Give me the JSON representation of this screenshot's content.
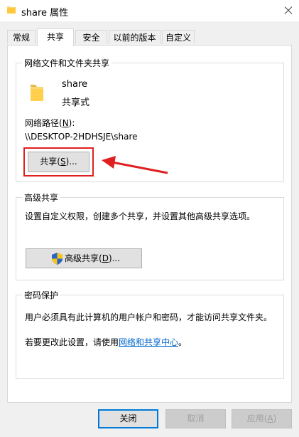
{
  "window": {
    "title": "share 属性",
    "close_icon": "close-icon"
  },
  "tabs": [
    {
      "label": "常规",
      "active": false
    },
    {
      "label": "共享",
      "active": true
    },
    {
      "label": "安全",
      "active": false
    },
    {
      "label": "以前的版本",
      "active": false
    },
    {
      "label": "自定义",
      "active": false
    }
  ],
  "network_sharing": {
    "group_title": "网络文件和文件夹共享",
    "folder_name": "share",
    "share_status": "共享式",
    "path_label_prefix": "网络路径(",
    "path_label_key": "N",
    "path_label_suffix": "):",
    "path_value": "\\\\DESKTOP-2HDHSJE\\share",
    "share_button_prefix": "共享(",
    "share_button_key": "S",
    "share_button_suffix": ")...",
    "highlight_color": "#e02020"
  },
  "advanced_sharing": {
    "group_title": "高级共享",
    "description": "设置自定义权限，创建多个共享，并设置其他高级共享选项。",
    "button_prefix": "高级共享(",
    "button_key": "D",
    "button_suffix": ")..."
  },
  "password_protection": {
    "group_title": "密码保护",
    "description": "用户必须具有此计算机的用户帐户和密码，才能访问共享文件夹。",
    "change_prefix": "若要更改此设置，请使用",
    "change_link": "网络和共享中心",
    "change_suffix": "。"
  },
  "footer": {
    "close_label": "关闭",
    "cancel_label": "取消",
    "apply_prefix": "应用(",
    "apply_key": "A",
    "apply_suffix": ")"
  },
  "colors": {
    "link": "#0066cc",
    "annotation_red": "#e02020",
    "folder_yellow": "#f8d775"
  }
}
